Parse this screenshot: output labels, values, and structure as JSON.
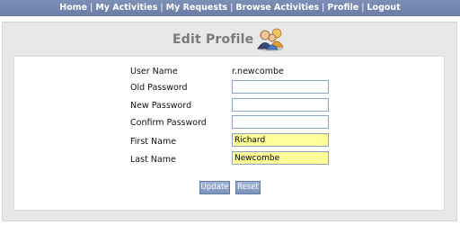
{
  "nav": {
    "items": [
      "Home",
      "My Activities",
      "My Requests",
      "Browse Activities",
      "Profile",
      "Logout"
    ],
    "separator": "|"
  },
  "page": {
    "title": "Edit Profile",
    "icon": "users-group-icon"
  },
  "form": {
    "user_name": {
      "label": "User Name",
      "value": "r.newcombe"
    },
    "old_password": {
      "label": "Old Password",
      "value": ""
    },
    "new_password": {
      "label": "New Password",
      "value": ""
    },
    "confirm_password": {
      "label": "Confirm Password",
      "value": ""
    },
    "first_name": {
      "label": "First Name",
      "value": "Richard"
    },
    "last_name": {
      "label": "Last Name",
      "value": "Newcombe"
    }
  },
  "buttons": {
    "update": "Update",
    "reset": "Reset"
  },
  "colors": {
    "nav_bar": "#7585ad",
    "filled_field": "#ffff99",
    "button": "#8a9fc9"
  }
}
